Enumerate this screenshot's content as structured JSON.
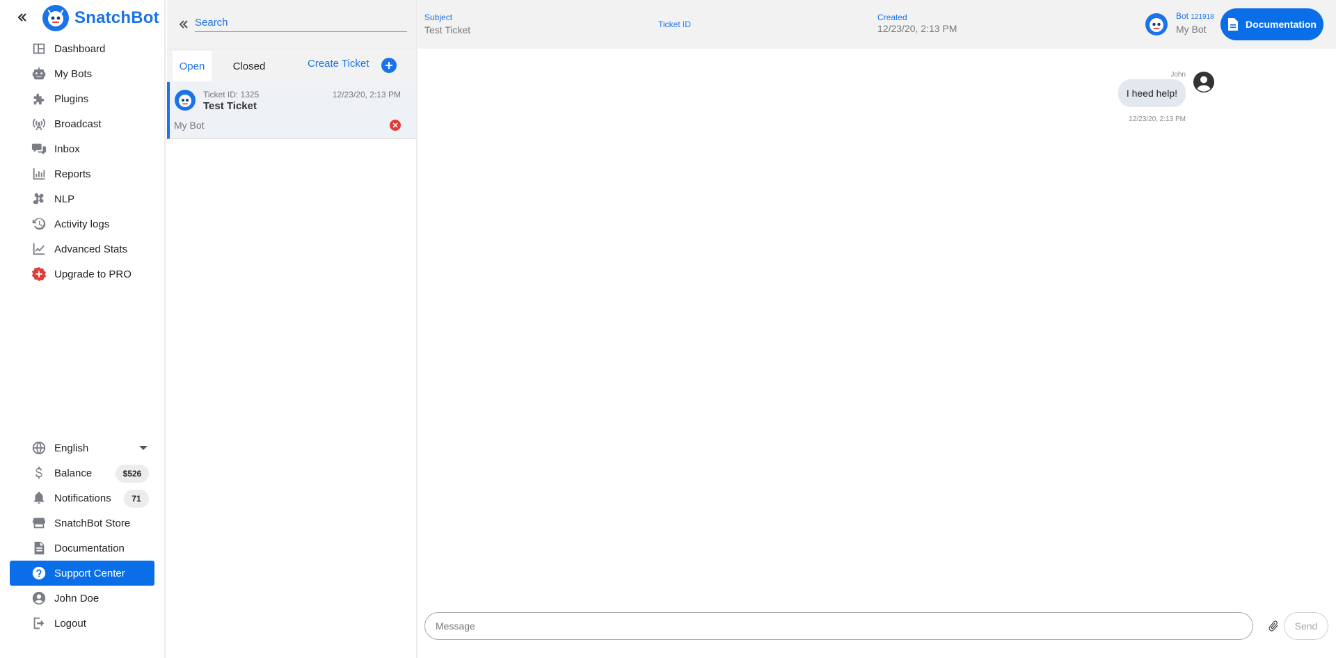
{
  "brand": {
    "name": "SnatchBot"
  },
  "sidebar": {
    "items": [
      {
        "label": "Dashboard",
        "icon": "dashboard-icon"
      },
      {
        "label": "My Bots",
        "icon": "robot-icon"
      },
      {
        "label": "Plugins",
        "icon": "puzzle-icon"
      },
      {
        "label": "Broadcast",
        "icon": "broadcast-icon"
      },
      {
        "label": "Inbox",
        "icon": "chat-icon"
      },
      {
        "label": "Reports",
        "icon": "bar-chart-icon"
      },
      {
        "label": "NLP",
        "icon": "nlp-icon"
      },
      {
        "label": "Activity logs",
        "icon": "history-icon"
      },
      {
        "label": "Advanced Stats",
        "icon": "line-chart-icon"
      },
      {
        "label": "Upgrade to PRO",
        "icon": "upgrade-icon",
        "color": "#e53935"
      }
    ],
    "bottom_items": [
      {
        "label": "English",
        "icon": "globe-icon"
      },
      {
        "label": "Balance",
        "icon": "dollar-icon",
        "badge": "$526"
      },
      {
        "label": "Notifications",
        "icon": "bell-icon",
        "badge": "71"
      },
      {
        "label": "SnatchBot Store",
        "icon": "store-icon"
      },
      {
        "label": "Documentation",
        "icon": "document-icon"
      },
      {
        "label": "Support Center",
        "icon": "help-icon",
        "active": true
      },
      {
        "label": "John Doe",
        "icon": "user-icon"
      },
      {
        "label": "Logout",
        "icon": "logout-icon"
      }
    ]
  },
  "ticket_list": {
    "search_placeholder": "Search",
    "tabs": {
      "open": "Open",
      "closed": "Closed"
    },
    "create_ticket": "Create Ticket",
    "tickets": [
      {
        "id_label": "Ticket ID: 1325",
        "date": "12/23/20, 2:13 PM",
        "title": "Test Ticket",
        "bot": "My Bot"
      }
    ]
  },
  "chat_header": {
    "subject_label": "Subject",
    "subject_value": "Test Ticket",
    "ticket_id_label": "Ticket ID",
    "created_label": "Created",
    "created_value": "12/23/20, 2:13 PM",
    "bot_label": "Bot",
    "bot_id": "121918",
    "bot_name": "My Bot",
    "documentation_button": "Documentation"
  },
  "messages": [
    {
      "author": "John",
      "text": "I heed help!",
      "time": "12/23/20, 2:13 PM"
    }
  ],
  "composer": {
    "placeholder": "Message",
    "send_label": "Send"
  },
  "colors": {
    "accent": "#1a73e8",
    "active_bg": "#0a6ee8",
    "danger": "#e53935"
  }
}
